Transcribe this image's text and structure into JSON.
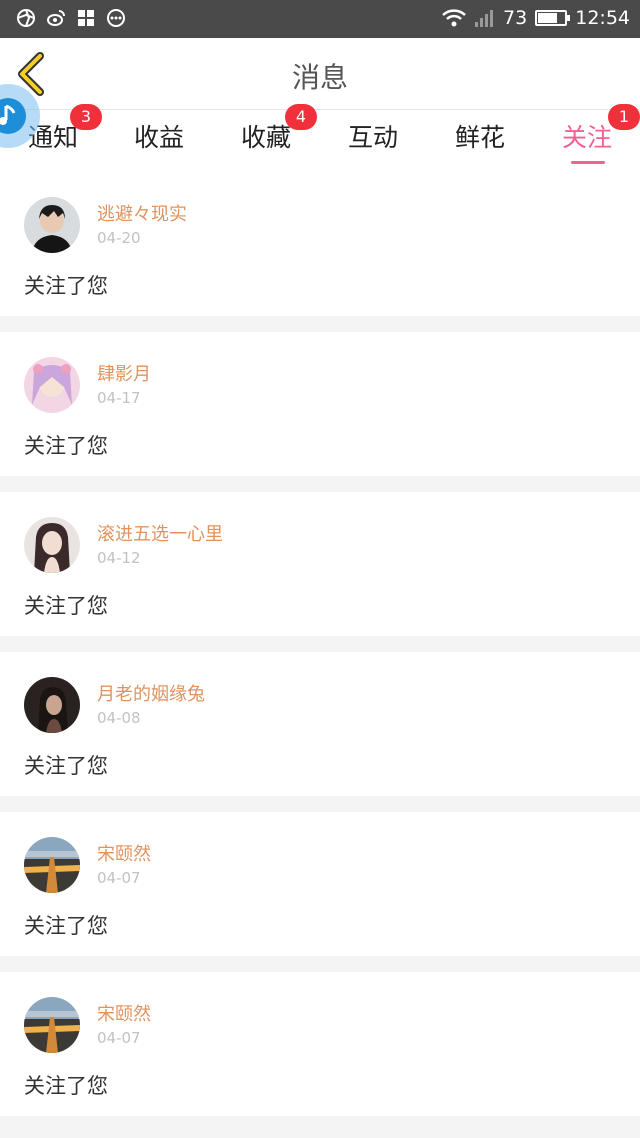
{
  "status_bar": {
    "battery": "73",
    "time": "12:54",
    "battery_level": 0.73
  },
  "header": {
    "title": "消息"
  },
  "tabs": [
    {
      "label": "通知",
      "badge": "3"
    },
    {
      "label": "收益",
      "badge": ""
    },
    {
      "label": "收藏",
      "badge": "4"
    },
    {
      "label": "互动",
      "badge": ""
    },
    {
      "label": "鲜花",
      "badge": ""
    },
    {
      "label": "关注",
      "badge": "1",
      "active": true
    }
  ],
  "messages": [
    {
      "name": "逃避々现实",
      "date": "04-20",
      "text": "关注了您"
    },
    {
      "name": "肆影月",
      "date": "04-17",
      "text": "关注了您"
    },
    {
      "name": "滚进五选一心里",
      "date": "04-12",
      "text": "关注了您"
    },
    {
      "name": "月老的姻缘兔",
      "date": "04-08",
      "text": "关注了您"
    },
    {
      "name": "宋颐然",
      "date": "04-07",
      "text": "关注了您"
    },
    {
      "name": "宋颐然",
      "date": "04-07",
      "text": "关注了您"
    }
  ],
  "colors": {
    "accent": "#f06292",
    "name": "#e0935e",
    "badge": "#f0303a",
    "back_arrow": "#f5d020"
  }
}
